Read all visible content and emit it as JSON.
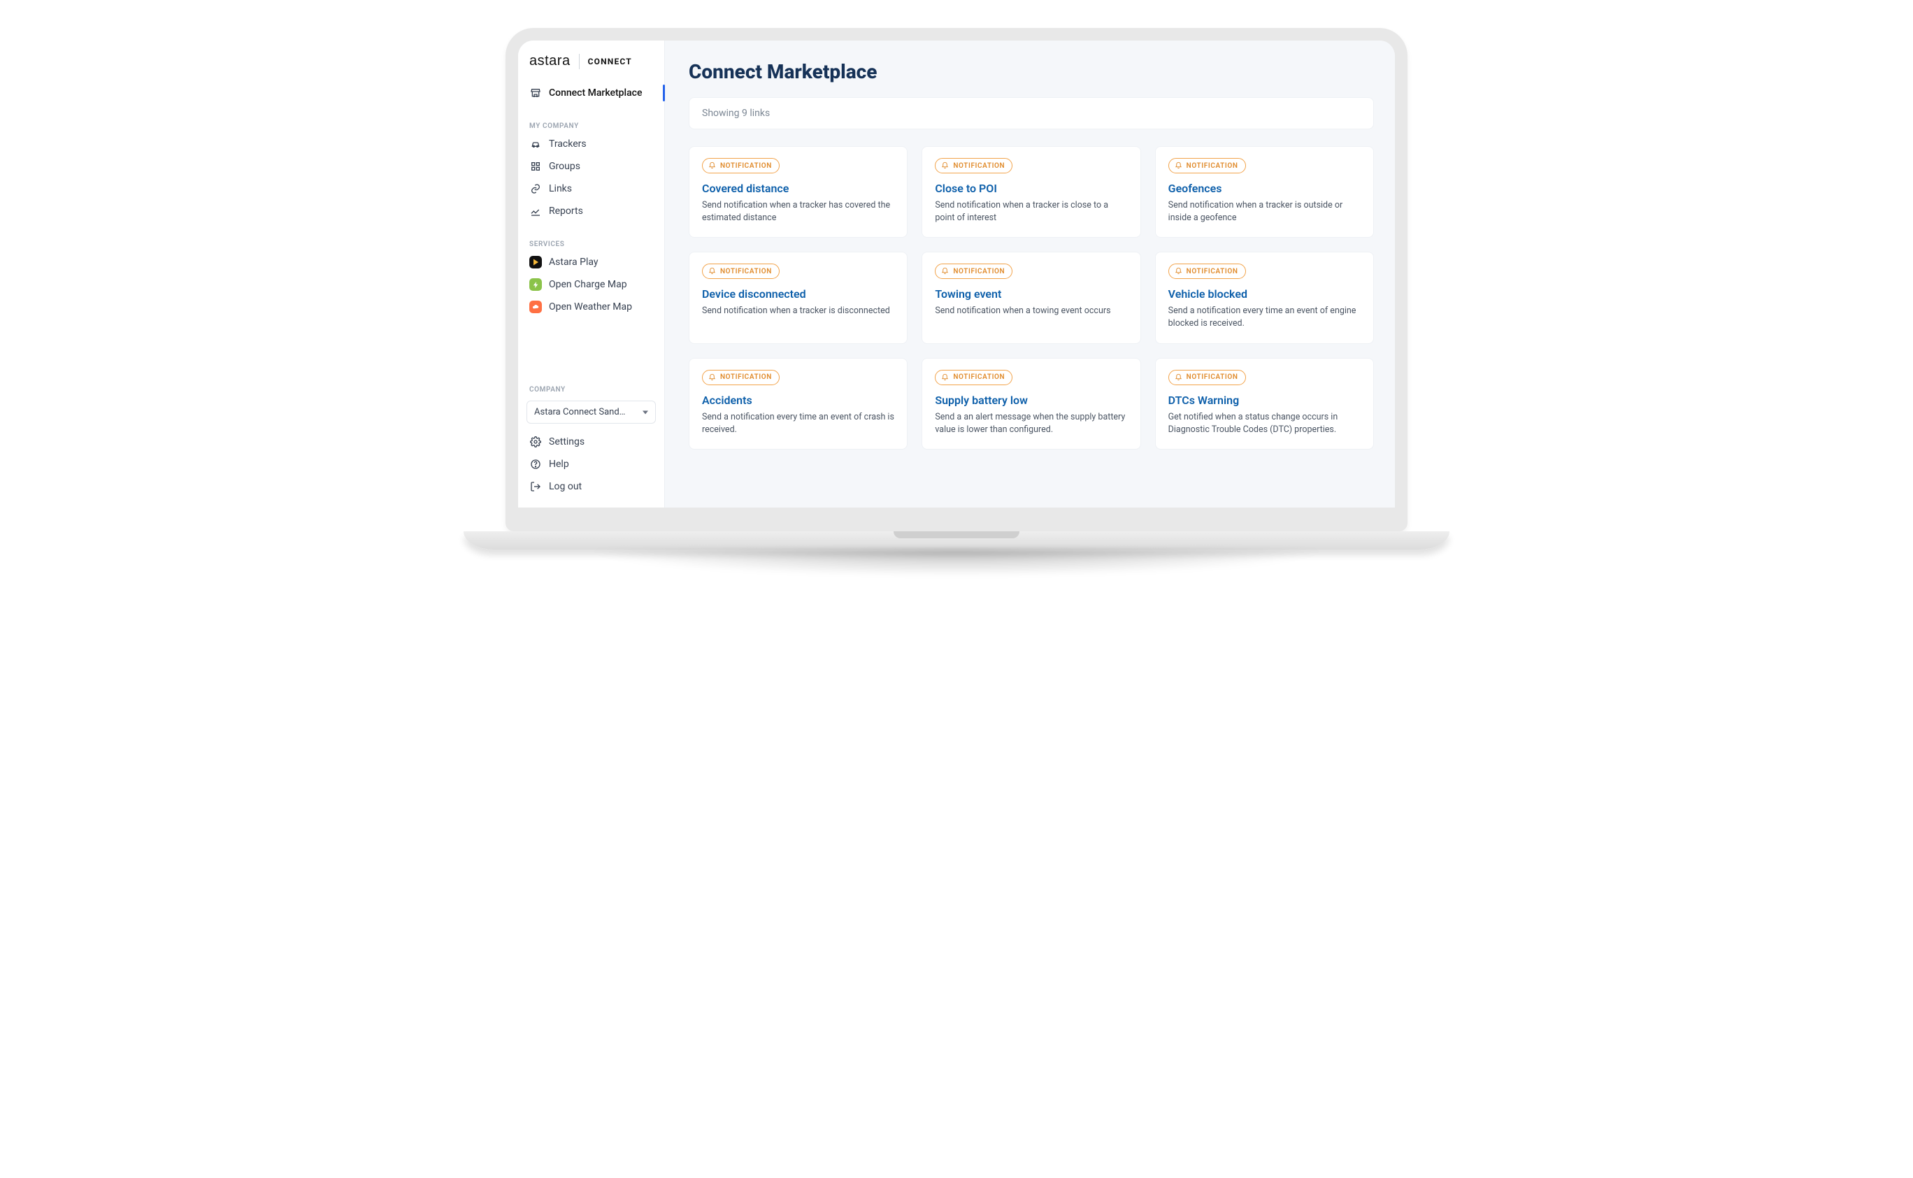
{
  "brand": {
    "primary": "astara",
    "secondary": "CONNECT"
  },
  "sidebar": {
    "top_item": {
      "label": "Connect Marketplace"
    },
    "sections": [
      {
        "heading": "MY COMPANY",
        "items": [
          {
            "label": "Trackers"
          },
          {
            "label": "Groups"
          },
          {
            "label": "Links"
          },
          {
            "label": "Reports"
          }
        ]
      },
      {
        "heading": "SERVICES",
        "items": [
          {
            "label": "Astara Play"
          },
          {
            "label": "Open Charge Map"
          },
          {
            "label": "Open Weather Map"
          }
        ]
      }
    ],
    "company_heading": "COMPANY",
    "company_value": "Astara Connect Sand…",
    "footer": [
      {
        "label": "Settings"
      },
      {
        "label": "Help"
      },
      {
        "label": "Log out"
      }
    ]
  },
  "main": {
    "title": "Connect Marketplace",
    "count_text": "Showing 9 links",
    "badge_label": "NOTIFICATION",
    "cards": [
      {
        "title": "Covered distance",
        "desc": "Send notification when a tracker has covered the estimated distance"
      },
      {
        "title": "Close to POI",
        "desc": "Send notification when a tracker is close to a point of interest"
      },
      {
        "title": "Geofences",
        "desc": "Send notification when a tracker is outside or inside a geofence"
      },
      {
        "title": "Device disconnected",
        "desc": "Send notification when a tracker is disconnected"
      },
      {
        "title": "Towing event",
        "desc": "Send notification when a towing event occurs"
      },
      {
        "title": "Vehicle blocked",
        "desc": "Send a notification every time an event of engine blocked is received."
      },
      {
        "title": "Accidents",
        "desc": "Send a notification every time an event of crash is received."
      },
      {
        "title": "Supply battery low",
        "desc": "Send a an alert message when the supply battery value is lower than configured."
      },
      {
        "title": "DTCs Warning",
        "desc": "Get notified when a status change occurs in Diagnostic Trouble Codes (DTC) properties."
      }
    ]
  },
  "colors": {
    "accent": "#2563eb",
    "title": "#163257",
    "link": "#0d5faa",
    "badge_border": "#f2a34a",
    "badge_text": "#e08a2a"
  }
}
